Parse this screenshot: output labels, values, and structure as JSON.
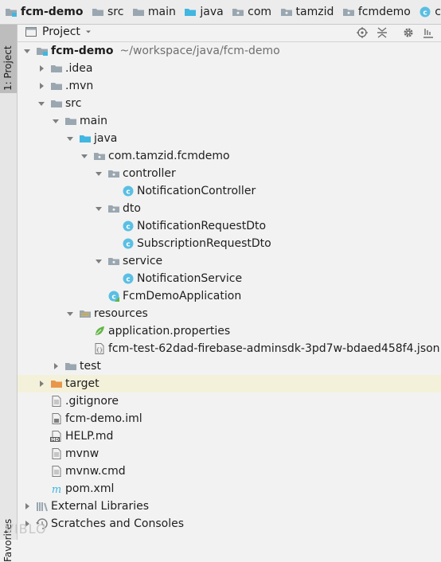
{
  "breadcrumb": [
    "fcm-demo",
    "src",
    "main",
    "java",
    "com",
    "tamzid",
    "fcmdemo",
    "c"
  ],
  "stripe": {
    "project_tab": "1: Project",
    "favorites_tab": "Favorites"
  },
  "panel": {
    "title": "Project"
  },
  "tree": [
    {
      "label": "fcm-demo",
      "path": "~/workspace/java/fcm-demo",
      "icon": "module-folder-icon",
      "arrow": "down",
      "depth": 0,
      "bold": true
    },
    {
      "label": ".idea",
      "icon": "folder-icon",
      "arrow": "right",
      "depth": 1
    },
    {
      "label": ".mvn",
      "icon": "folder-icon",
      "arrow": "right",
      "depth": 1
    },
    {
      "label": "src",
      "icon": "folder-icon",
      "arrow": "down",
      "depth": 1
    },
    {
      "label": "main",
      "icon": "folder-icon",
      "arrow": "down",
      "depth": 2
    },
    {
      "label": "java",
      "icon": "source-folder-icon",
      "arrow": "down",
      "depth": 3
    },
    {
      "label": "com.tamzid.fcmdemo",
      "icon": "package-icon",
      "arrow": "down",
      "depth": 4
    },
    {
      "label": "controller",
      "icon": "package-icon",
      "arrow": "down",
      "depth": 5
    },
    {
      "label": "NotificationController",
      "icon": "class-icon",
      "depth": 6
    },
    {
      "label": "dto",
      "icon": "package-icon",
      "arrow": "down",
      "depth": 5
    },
    {
      "label": "NotificationRequestDto",
      "icon": "class-icon",
      "depth": 6
    },
    {
      "label": "SubscriptionRequestDto",
      "icon": "class-icon",
      "depth": 6
    },
    {
      "label": "service",
      "icon": "package-icon",
      "arrow": "down",
      "depth": 5
    },
    {
      "label": "NotificationService",
      "icon": "class-icon",
      "depth": 6
    },
    {
      "label": "FcmDemoApplication",
      "icon": "spring-class-icon",
      "depth": 5
    },
    {
      "label": "resources",
      "icon": "resources-folder-icon",
      "arrow": "down",
      "depth": 3
    },
    {
      "label": "application.properties",
      "icon": "spring-leaf-icon",
      "depth": 4
    },
    {
      "label": "fcm-test-62dad-firebase-adminsdk-3pd7w-bdaed458f4.json",
      "icon": "json-file-icon",
      "depth": 4
    },
    {
      "label": "test",
      "icon": "folder-icon",
      "arrow": "right",
      "depth": 2
    },
    {
      "label": "target",
      "icon": "excluded-folder-icon",
      "arrow": "right",
      "depth": 1,
      "highlight": true
    },
    {
      "label": ".gitignore",
      "icon": "text-file-icon",
      "depth": 1
    },
    {
      "label": "fcm-demo.iml",
      "icon": "iml-file-icon",
      "depth": 1
    },
    {
      "label": "HELP.md",
      "icon": "markdown-file-icon",
      "depth": 1
    },
    {
      "label": "mvnw",
      "icon": "text-file-icon",
      "depth": 1
    },
    {
      "label": "mvnw.cmd",
      "icon": "text-file-icon",
      "depth": 1
    },
    {
      "label": "pom.xml",
      "icon": "maven-file-icon",
      "depth": 1
    },
    {
      "label": "External Libraries",
      "icon": "libraries-icon",
      "arrow": "right",
      "depth": 0
    },
    {
      "label": "Scratches and Consoles",
      "icon": "scratches-icon",
      "arrow": "right",
      "depth": 0
    }
  ],
  "watermark": "VIBLO"
}
